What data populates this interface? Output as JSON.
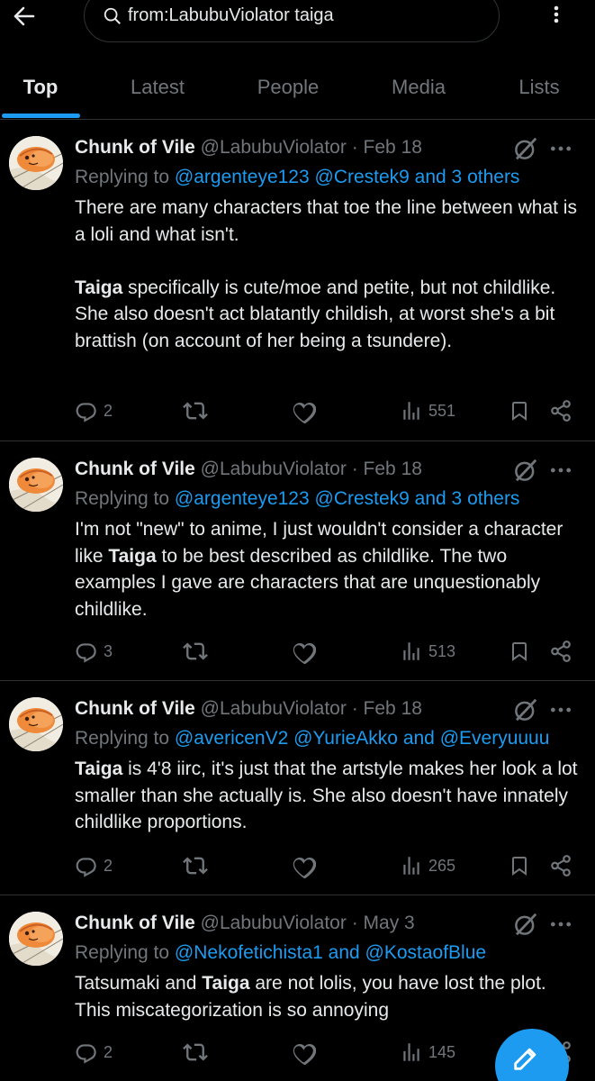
{
  "search": {
    "query": "from:LabubuViolator taiga"
  },
  "tabs": [
    {
      "label": "Top",
      "active": true
    },
    {
      "label": "Latest"
    },
    {
      "label": "People"
    },
    {
      "label": "Media"
    },
    {
      "label": "Lists"
    }
  ],
  "colors": {
    "accent": "#1d9bf0",
    "background": "#000000",
    "muted": "#71767b",
    "text": "#e7e9ea"
  },
  "tweets": [
    {
      "name": "Chunk of Vile",
      "handle": "@LabubuViolator",
      "date": "Feb 18",
      "replying_prefix": "Replying to",
      "replying_mentions": "@argenteye123 @Crestek9 and 3 others",
      "body_p1": "There are many characters that toe the line between what is a loli and what isn't.",
      "body_p2_bold": "Taiga",
      "body_p2_rest": " specifically is cute/moe and petite, but not childlike. She also doesn't act blatantly childish, at worst she's a bit brattish (on account of her being a tsundere).",
      "replies": "2",
      "views": "551"
    },
    {
      "name": "Chunk of Vile",
      "handle": "@LabubuViolator",
      "date": "Feb 18",
      "replying_prefix": "Replying to",
      "replying_mentions": "@argenteye123 @Crestek9 and 3 others",
      "body_a": "I'm not \"new\" to anime, I just wouldn't consider a character like ",
      "body_bold": "Taiga",
      "body_b": " to be best described as childlike. The two examples I gave are characters that are unquestionably childlike.",
      "replies": "3",
      "views": "513"
    },
    {
      "name": "Chunk of Vile",
      "handle": "@LabubuViolator",
      "date": "Feb 18",
      "replying_prefix": "Replying to",
      "replying_mentions": "@avericenV2 @YurieAkko and @Everyuuuu",
      "body_bold": "Taiga",
      "body_b": " is 4'8 iirc, it's just that the artstyle makes her look a lot smaller than she actually is. She also doesn't have innately childlike proportions.",
      "replies": "2",
      "views": "265"
    },
    {
      "name": "Chunk of Vile",
      "handle": "@LabubuViolator",
      "date": "May 3",
      "replying_prefix": "Replying to",
      "replying_mentions": "@Nekofetichista1 and @KostaofBlue",
      "body_a": "Tatsumaki and ",
      "body_bold": "Taiga",
      "body_b": " are not lolis, you have lost the plot. This miscategorization is so annoying",
      "replies": "2",
      "views": "145"
    }
  ]
}
